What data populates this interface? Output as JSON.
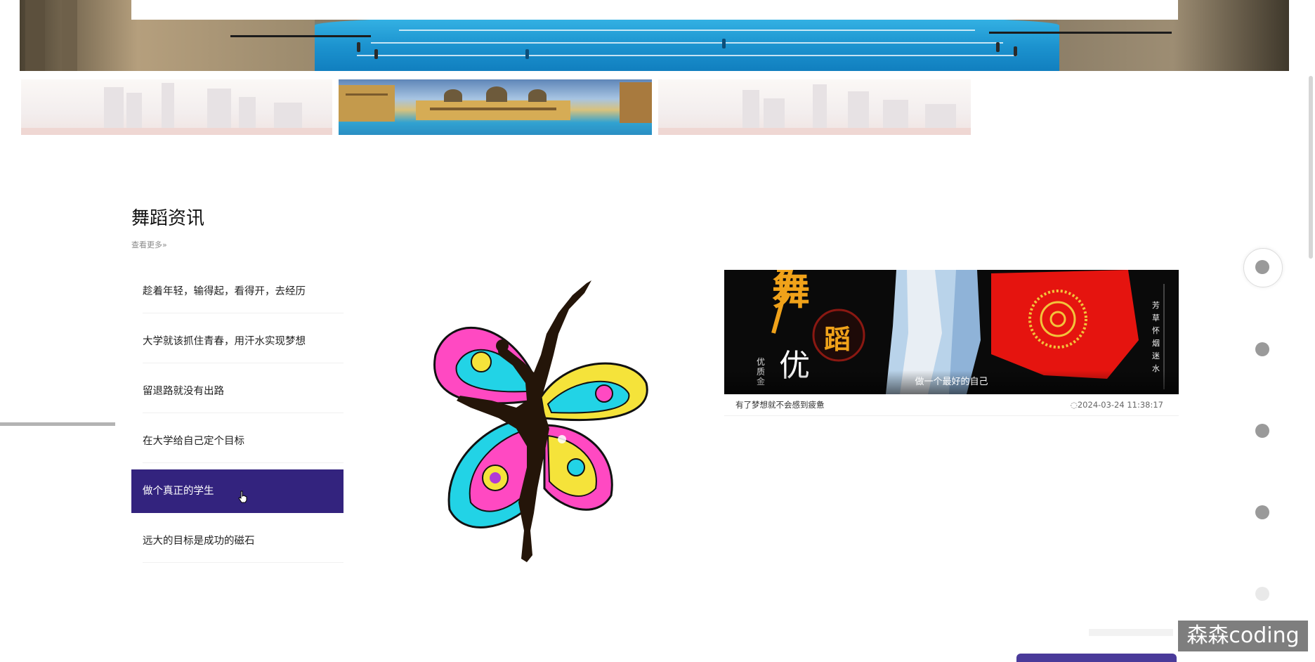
{
  "section": {
    "title": "舞蹈资讯",
    "more_label": "查看更多»"
  },
  "news_list": [
    {
      "title": "趁着年轻，输得起，看得开，去经历",
      "active": false
    },
    {
      "title": "大学就该抓住青春，用汗水实现梦想",
      "active": false
    },
    {
      "title": "留退路就没有出路",
      "active": false
    },
    {
      "title": "在大学给自己定个目标",
      "active": false
    },
    {
      "title": "做个真正的学生",
      "active": true
    },
    {
      "title": "远大的目标是成功的磁石",
      "active": false
    }
  ],
  "featured": {
    "caption": "做一个最好的自己",
    "title": "有了梦想就不会感到疲惫",
    "date": "◌2024-03-24 11:38:17",
    "poster_text": {
      "char1": "舞",
      "char2": "蹈",
      "word": "优",
      "sub": "优质金",
      "vertical": "芳草怀烟迷水"
    }
  },
  "watermark": "森森coding",
  "colors": {
    "active_bg": "#33237e",
    "dot": "#9a9a9a"
  }
}
